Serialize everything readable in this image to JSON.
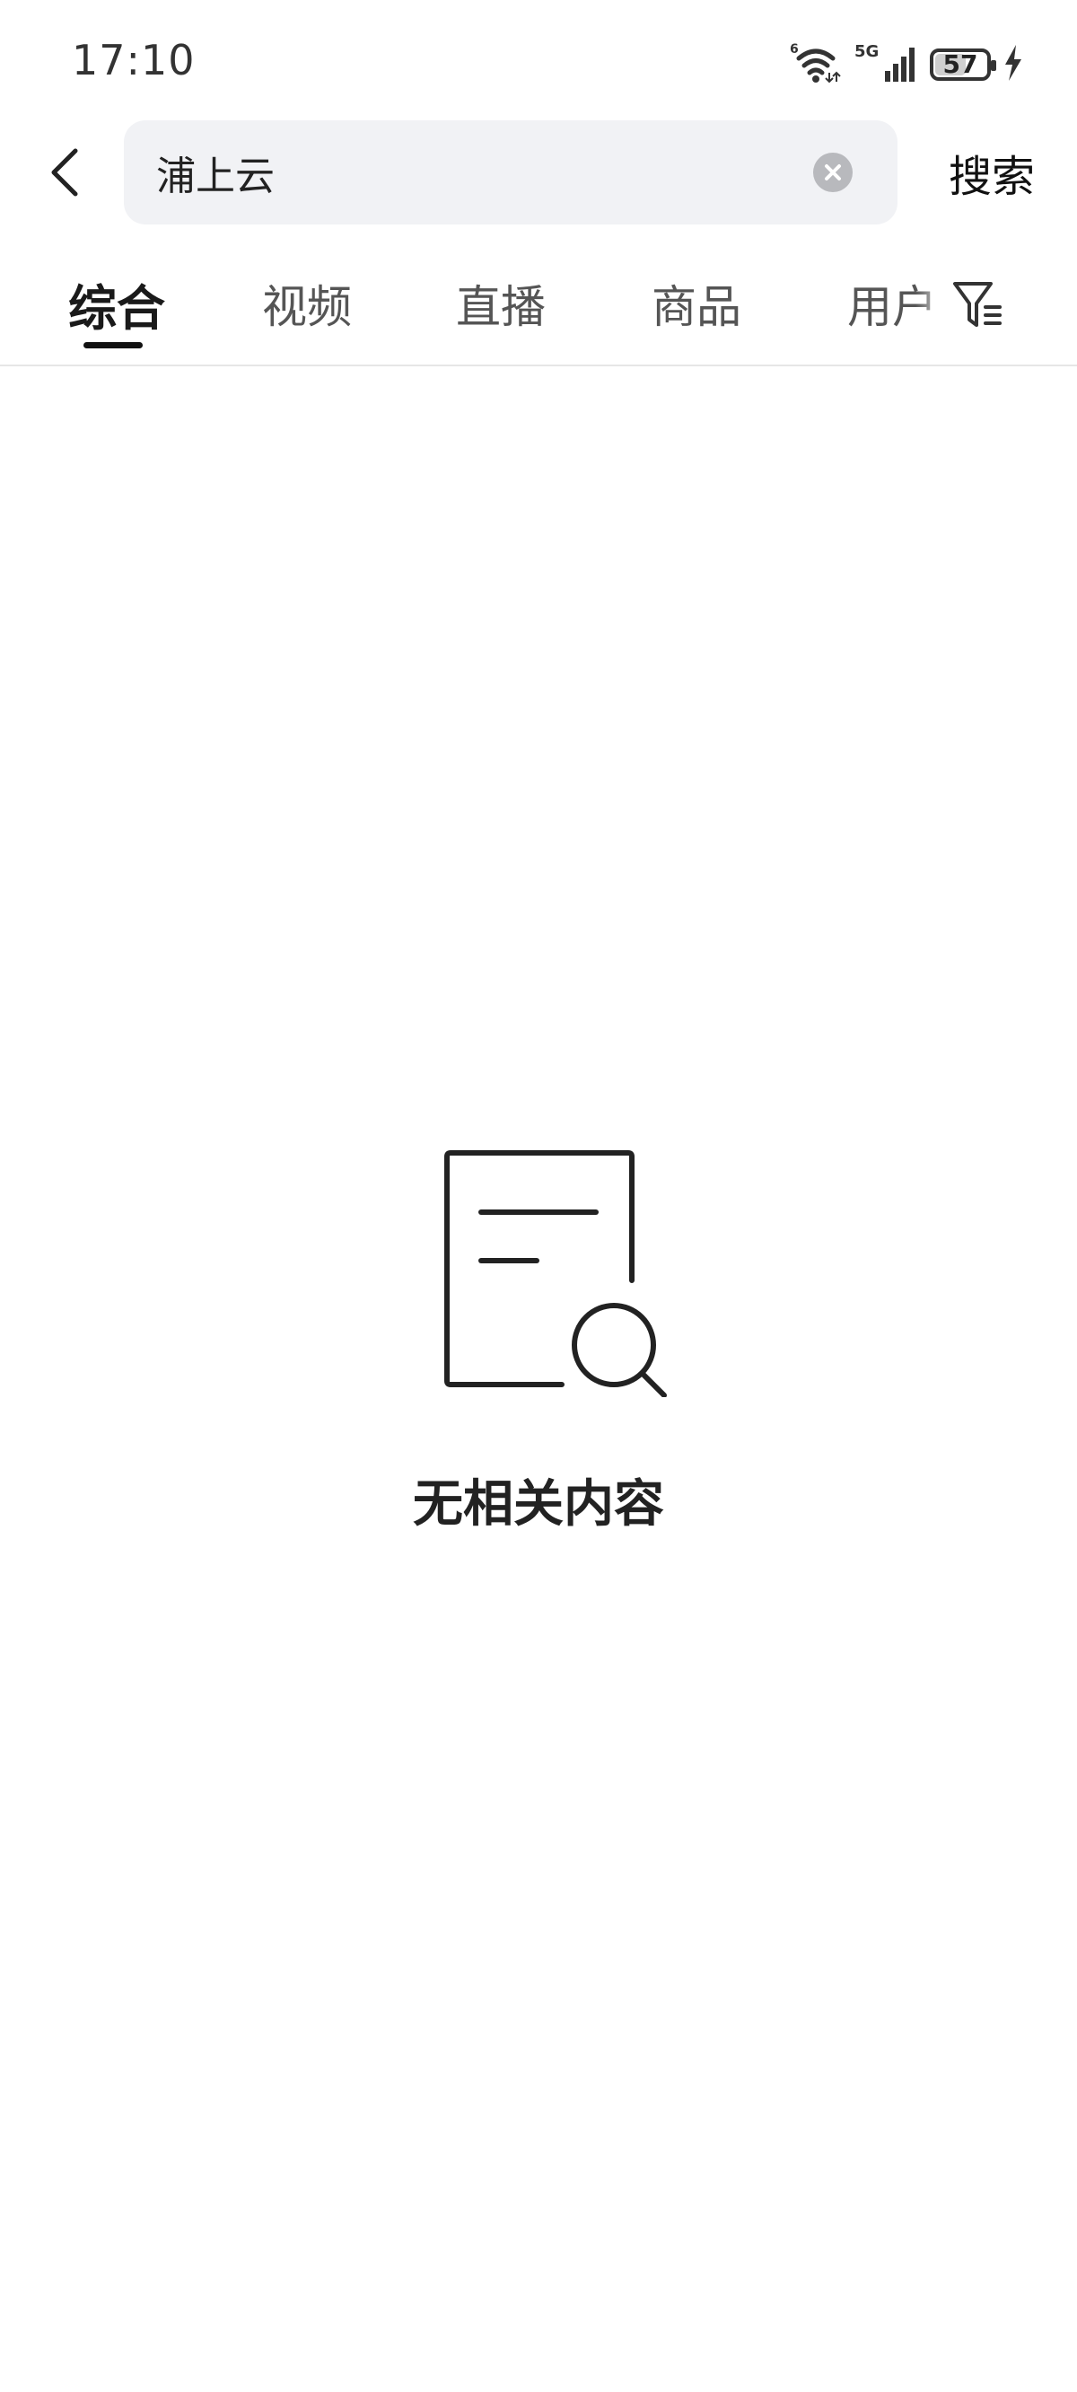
{
  "status_bar": {
    "time": "17:10",
    "battery": "57",
    "battery_level": 0.57,
    "wifi_badge": "6",
    "network_badge": "5G"
  },
  "header": {
    "search_value": "浦上云",
    "search_button_label": "搜索"
  },
  "tabs": [
    {
      "label": "综合",
      "active": true
    },
    {
      "label": "视频",
      "active": false
    },
    {
      "label": "直播",
      "active": false
    },
    {
      "label": "商品",
      "active": false
    },
    {
      "label": "用户",
      "active": false
    }
  ],
  "empty_state": {
    "message": "无相关内容",
    "icon": "document-search-icon"
  },
  "colors": {
    "search_bg": "#f1f2f5",
    "text_primary": "#222222",
    "tab_inactive": "#555555"
  }
}
